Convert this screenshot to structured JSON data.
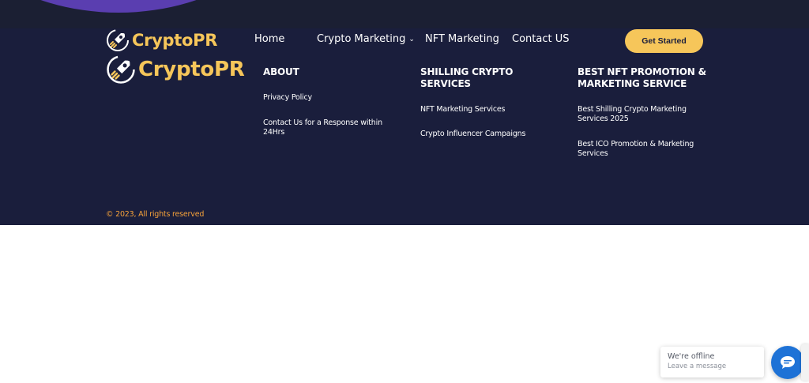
{
  "brand": {
    "name": "CryptoPR",
    "logo_icon": "rocket-icon",
    "accent": "#f6c65a",
    "background": "#1a1e3c"
  },
  "nav": {
    "items": [
      {
        "label": "Home"
      },
      {
        "label": "Crypto Marketing",
        "icon": "chevron-down-icon"
      },
      {
        "label": "NFT Marketing"
      },
      {
        "label": "Contact US"
      }
    ],
    "cta": "Get Started"
  },
  "footer": {
    "columns": [
      {
        "heading": "ABOUT",
        "links": [
          "Privacy Policy",
          "Contact Us for a Response within 24Hrs"
        ]
      },
      {
        "heading": "SHILLING CRYPTO SERVICES",
        "links": [
          "NFT Marketing Services",
          "Crypto Influencer Campaigns"
        ]
      },
      {
        "heading": "BEST NFT PROMOTION & MARKETING SERVICE",
        "links": [
          "Best Shilling Crypto Marketing Services 2025",
          "Best ICO Promotion & Marketing Services"
        ]
      }
    ],
    "copyright": "© 2023, All rights reserved",
    "copyright_color": "#f6a23a"
  },
  "chat": {
    "status": "We're offline",
    "action": "Leave a message",
    "bubble_color": "#1e72d6",
    "icon": "chat-icon"
  }
}
